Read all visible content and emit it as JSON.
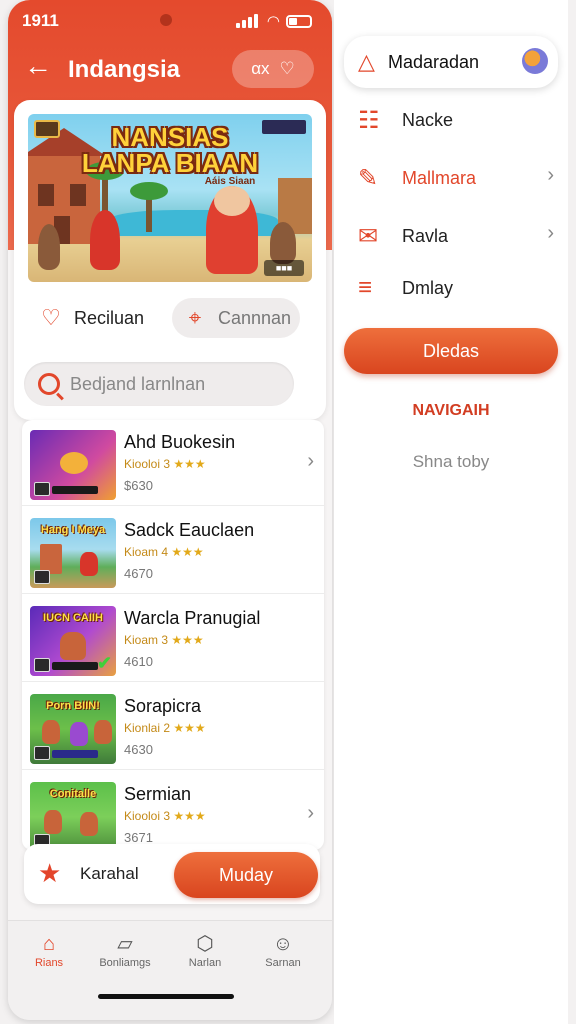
{
  "status_bar": {
    "time": "1911"
  },
  "header": {
    "title": "Indangsia",
    "pill_text": "αx"
  },
  "banner": {
    "title_line1": "NANSIAS",
    "title_line2": "LANPA BIAAN",
    "subtitle": "Aáis Siaan"
  },
  "chips": {
    "favorite_label": "Reciluan",
    "location_label": "Cannnan"
  },
  "search": {
    "placeholder": "Bedjand larnlnan"
  },
  "list": [
    {
      "name": "Ahd Buokesin",
      "meta": "Kiooloi 3",
      "stars": "★★★",
      "price": "$630",
      "thumb_title": "",
      "has_chevron": true
    },
    {
      "name": "Sadck Eauclaen",
      "meta": "Kioam 4",
      "stars": "★★★",
      "price": "4670",
      "thumb_title": "Hang I Meya",
      "has_chevron": false
    },
    {
      "name": "Warcla Pranugial",
      "meta": "Kioam 3",
      "stars": "★★★",
      "price": "4610",
      "thumb_title": "IUCN CAIIH",
      "has_chevron": false
    },
    {
      "name": "Sorapicra",
      "meta": "Kionlai 2",
      "stars": "★★★",
      "price": "4630",
      "thumb_title": "Porn BIIN!",
      "has_chevron": false
    },
    {
      "name": "Sermian",
      "meta": "Kiooloi 3",
      "stars": "★★★",
      "price": "3671",
      "thumb_title": "Conitalle",
      "has_chevron": true
    }
  ],
  "action_bar": {
    "label": "Karahal",
    "button": "Muday"
  },
  "tabs": [
    {
      "label": "Rians",
      "icon": "home-icon",
      "active": true
    },
    {
      "label": "Bonliamgs",
      "icon": "tag-icon",
      "active": false
    },
    {
      "label": "Narlan",
      "icon": "box-icon",
      "active": false
    },
    {
      "label": "Sarnan",
      "icon": "person-icon",
      "active": false
    }
  ],
  "drawer": {
    "header_label": "Madaradan",
    "items": [
      {
        "label": "Nacke",
        "icon": "grid-icon",
        "red": false,
        "chevron": false
      },
      {
        "label": "Mallmara",
        "icon": "pen-icon",
        "red": true,
        "chevron": true
      },
      {
        "label": "Ravla",
        "icon": "mail-icon",
        "red": false,
        "chevron": true
      },
      {
        "label": "Dmlay",
        "icon": "menu-icon",
        "red": false,
        "chevron": false
      }
    ],
    "button": "Dledas",
    "section_title": "NAVIGAIH",
    "section_sub": "Shna toby"
  },
  "colors": {
    "accent": "#e2472b",
    "accent_light": "#ee6f3c",
    "star": "#e2a91a"
  }
}
